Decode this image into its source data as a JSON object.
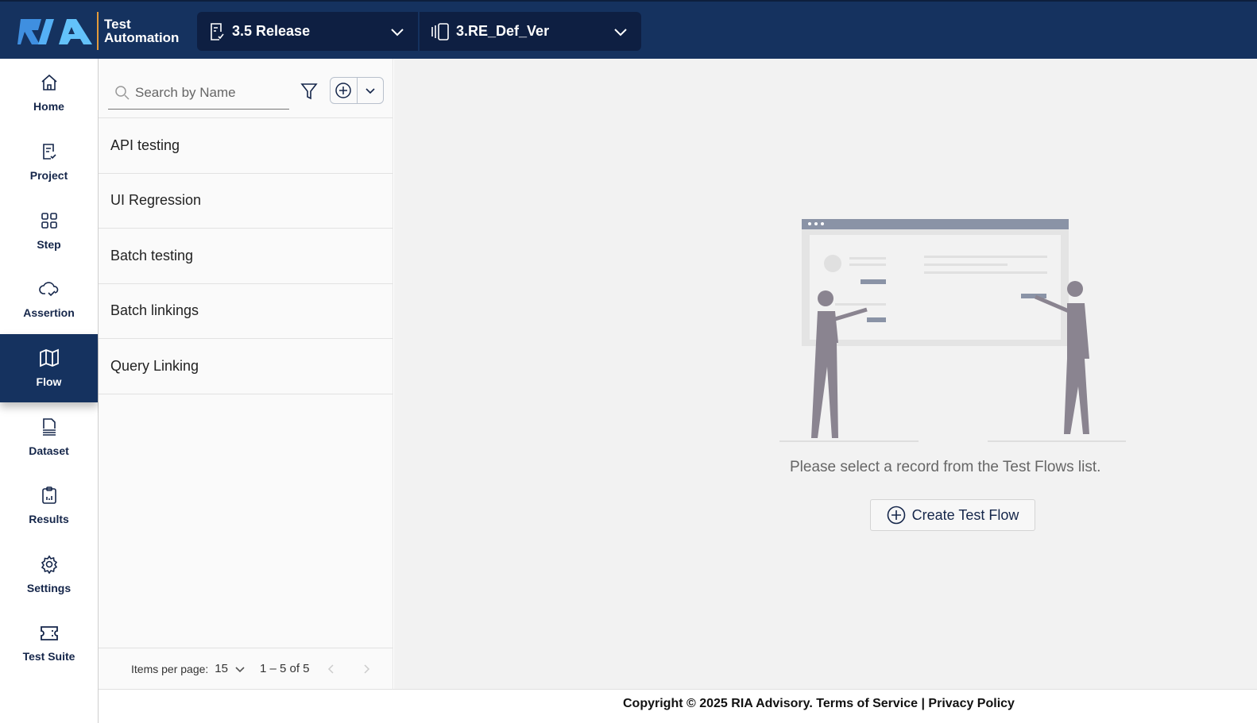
{
  "header": {
    "logo_text": "RIA",
    "brand_line1": "Test",
    "brand_line2": "Automation",
    "release": "3.5 Release",
    "version": "3.RE_Def_Ver"
  },
  "sidebar": {
    "items": [
      {
        "label": "Home"
      },
      {
        "label": "Project"
      },
      {
        "label": "Step"
      },
      {
        "label": "Assertion"
      },
      {
        "label": "Flow"
      },
      {
        "label": "Dataset"
      },
      {
        "label": "Results"
      },
      {
        "label": "Settings"
      },
      {
        "label": "Test Suite"
      }
    ]
  },
  "list": {
    "search_placeholder": "Search by Name",
    "items": [
      "API testing",
      "UI Regression",
      "Batch testing",
      "Batch linkings",
      "Query Linking"
    ],
    "pager": {
      "label": "Items per page:",
      "per_page": "15",
      "range": "1 – 5 of 5"
    }
  },
  "main": {
    "message": "Please select a record from the Test Flows list.",
    "create_label": "Create Test Flow"
  },
  "footer": {
    "copyright": "Copyright © 2025 RIA Advisory.",
    "terms": "Terms of Service",
    "sep": "|",
    "privacy": "Privacy Policy"
  },
  "colors": {
    "header": "#15325f",
    "accent": "#e29a3a",
    "logo": "#4aa3f0"
  }
}
